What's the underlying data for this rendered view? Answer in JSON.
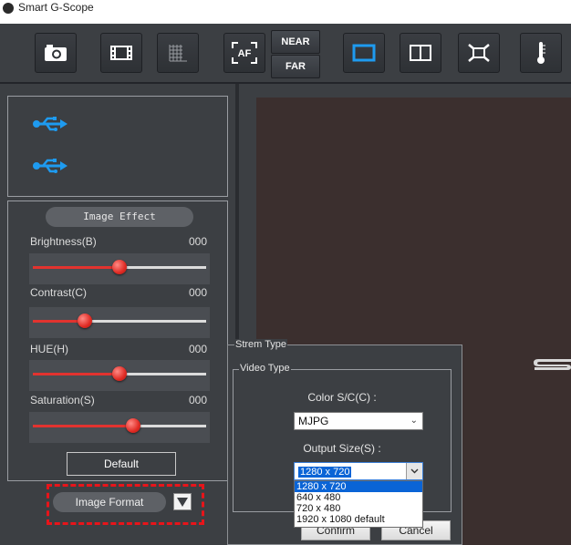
{
  "window": {
    "title": "Smart G-Scope"
  },
  "toolbar": {
    "buttons": [
      {
        "name": "camera-capture",
        "icon": "camera-icon"
      },
      {
        "name": "video-record",
        "icon": "film-icon"
      },
      {
        "name": "grid-measure",
        "icon": "grid-icon"
      },
      {
        "name": "auto-focus",
        "icon": "af-icon",
        "label": "AF"
      },
      {
        "name": "single-view",
        "icon": "single-window-icon"
      },
      {
        "name": "split-view",
        "icon": "split-window-icon"
      },
      {
        "name": "fullscreen",
        "icon": "fullscreen-icon"
      },
      {
        "name": "temperature",
        "icon": "thermometer-icon"
      }
    ],
    "near_label": "NEAR",
    "far_label": "FAR"
  },
  "image_effect": {
    "title": "Image Effect",
    "sliders": [
      {
        "label": "Brightness(B)",
        "value": "000",
        "level": 0.5
      },
      {
        "label": "Contrast(C)",
        "value": "000",
        "level": 0.3
      },
      {
        "label": "HUE(H)",
        "value": "000",
        "level": 0.5
      },
      {
        "label": "Saturation(S)",
        "value": "000",
        "level": 0.58
      }
    ],
    "default_label": "Default",
    "format_label": "Image Format"
  },
  "stream_dialog": {
    "stream_type_label": "Strem Type",
    "video_type_label": "Video Type",
    "color_label": "Color S/C(C) :",
    "color_value": "MJPG",
    "output_label": "Output Size(S) :",
    "output_value": "1280 x 720",
    "output_options": [
      "1280 x 720",
      "640 x 480",
      "720 x 480",
      "1920 x 1080 default"
    ],
    "confirm_label": "Confirm",
    "cancel_label": "Cancel"
  },
  "colors": {
    "panel": "#3c3f43",
    "accent_blue": "#1e9bf0",
    "slider_red": "#e2332f",
    "highlight_dash": "#e8141a",
    "selection": "#0a64d6"
  }
}
